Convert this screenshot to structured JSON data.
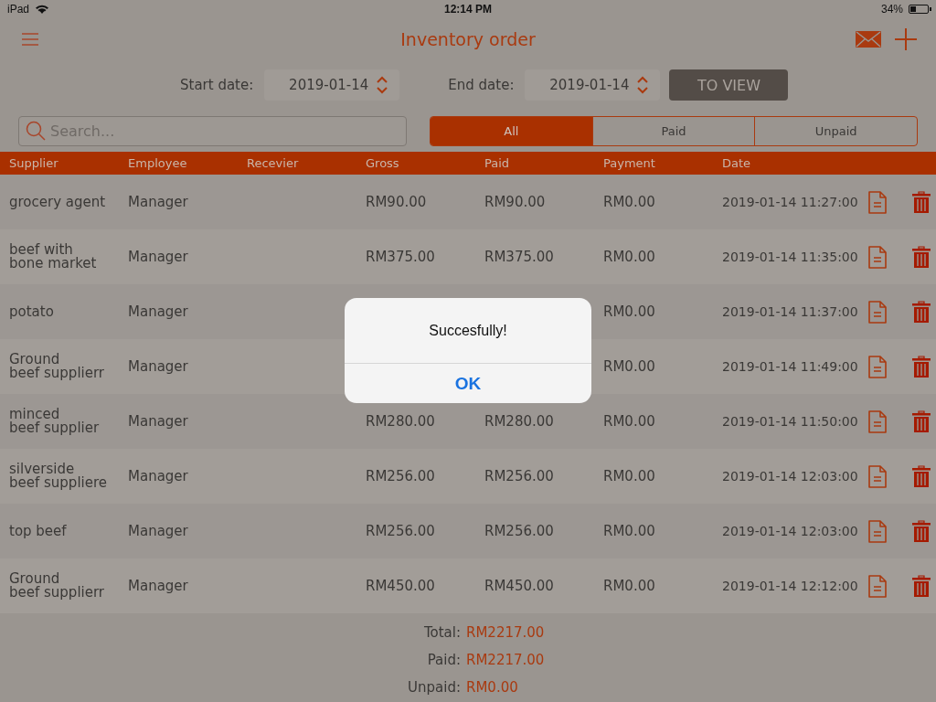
{
  "status_bar": {
    "carrier": "iPad",
    "time": "12:14 PM",
    "battery": "34%"
  },
  "nav": {
    "title": "Inventory order"
  },
  "filter": {
    "start_label": "Start date:",
    "start_value": "2019-01-14",
    "end_label": "End date:",
    "end_value": "2019-01-14",
    "button": "TO VIEW"
  },
  "search": {
    "placeholder": "Search..."
  },
  "segments": [
    {
      "label": "All",
      "selected": true
    },
    {
      "label": "Paid",
      "selected": false
    },
    {
      "label": "Unpaid",
      "selected": false
    }
  ],
  "table": {
    "columns": [
      "Supplier",
      "Employee",
      "Recevier",
      "Gross",
      "Paid",
      "Payment",
      "Date"
    ],
    "rows": [
      {
        "supplier": "grocery agent",
        "employee": "Manager",
        "gross": "RM90.00",
        "paid": "RM90.00",
        "payment": "RM0.00",
        "date": "2019-01-14 11:27:00"
      },
      {
        "supplier": "beef with\nbone market",
        "employee": "Manager",
        "gross": "RM375.00",
        "paid": "RM375.00",
        "payment": "RM0.00",
        "date": "2019-01-14 11:35:00"
      },
      {
        "supplier": "potato",
        "employee": "Manager",
        "payment": "RM0.00",
        "date": "2019-01-14 11:37:00"
      },
      {
        "supplier": "Ground\nbeef supplierr",
        "employee": "Manager",
        "payment": "RM0.00",
        "date": "2019-01-14 11:49:00"
      },
      {
        "supplier": "minced\nbeef supplier",
        "employee": "Manager",
        "gross": "RM280.00",
        "paid": "RM280.00",
        "payment": "RM0.00",
        "date": "2019-01-14 11:50:00"
      },
      {
        "supplier": "silverside\nbeef suppliere",
        "employee": "Manager",
        "gross": "RM256.00",
        "paid": "RM256.00",
        "payment": "RM0.00",
        "date": "2019-01-14 12:03:00"
      },
      {
        "supplier": "top beef",
        "employee": "Manager",
        "gross": "RM256.00",
        "paid": "RM256.00",
        "payment": "RM0.00",
        "date": "2019-01-14 12:03:00"
      },
      {
        "supplier": "Ground\nbeef supplierr",
        "employee": "Manager",
        "gross": "RM450.00",
        "paid": "RM450.00",
        "payment": "RM0.00",
        "date": "2019-01-14 12:12:00"
      }
    ]
  },
  "totals": [
    {
      "label": "Total:",
      "value": "RM2217.00"
    },
    {
      "label": "Paid:",
      "value": "RM2217.00"
    },
    {
      "label": "Unpaid:",
      "value": "RM0.00"
    }
  ],
  "alert": {
    "message": "Succesfully!",
    "button": "OK"
  }
}
